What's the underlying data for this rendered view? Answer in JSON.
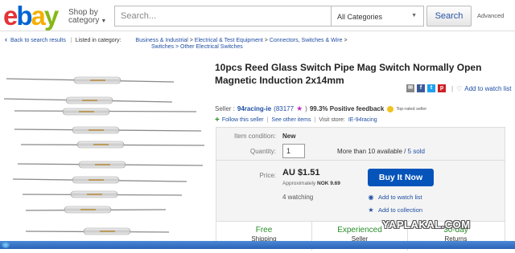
{
  "header": {
    "logo": [
      "e",
      "b",
      "a",
      "y"
    ],
    "logo_colors": [
      "#e53238",
      "#0064d2",
      "#f5af02",
      "#86b817"
    ],
    "shop_by_line1": "Shop by",
    "shop_by_line2": "category",
    "search_placeholder": "Search...",
    "category_select": "All Categories",
    "search_button": "Search",
    "advanced_link": "Advanced"
  },
  "breadcrumb": {
    "back": "Back to search results",
    "listed_in": "Listed in category:",
    "items": [
      "Business & Industrial",
      "Electrical & Test Equipment",
      "Connectors, Switches & Wire",
      "Switches",
      "Other Electrical Switches"
    ]
  },
  "listing": {
    "title": "10pcs Reed Glass Switch Pipe Mag Switch Normally Open Magnetic Induction 2x14mm",
    "watch_link": "Add to watch list",
    "seller_label": "Seller :",
    "seller_name": "94racing-ie",
    "seller_score": "(83177",
    "seller_score_close": ")",
    "feedback": "99.3% Positive feedback",
    "top_rated": "Top-rated seller",
    "follow": "Follow this seller",
    "see_other": "See other items",
    "visit_store": "Visit store:",
    "store_name": "IE-94racing"
  },
  "purchase": {
    "condition_label": "Item condition:",
    "condition": "New",
    "quantity_label": "Quantity:",
    "quantity": "1",
    "availability": "More than 10 available /",
    "sold": "5 sold",
    "price_label": "Price:",
    "price": "AU $1.51",
    "approx_label": "Approximately",
    "approx_value": "NOK 9.69",
    "watching": "4 watching",
    "buy_button": "Buy It Now",
    "add_watch": "Add to watch list",
    "add_collection": "Add to collection"
  },
  "bottom_bar": [
    {
      "title": "Free",
      "sub": "Shipping",
      "color": "#2a8d2a"
    },
    {
      "title": "Experienced",
      "sub": "Seller",
      "color": "#2a8d2a"
    },
    {
      "title": "30-day",
      "sub": "Returns",
      "color": "#2a8d2a"
    }
  ],
  "watermark": "YAPLAKAL.COM"
}
